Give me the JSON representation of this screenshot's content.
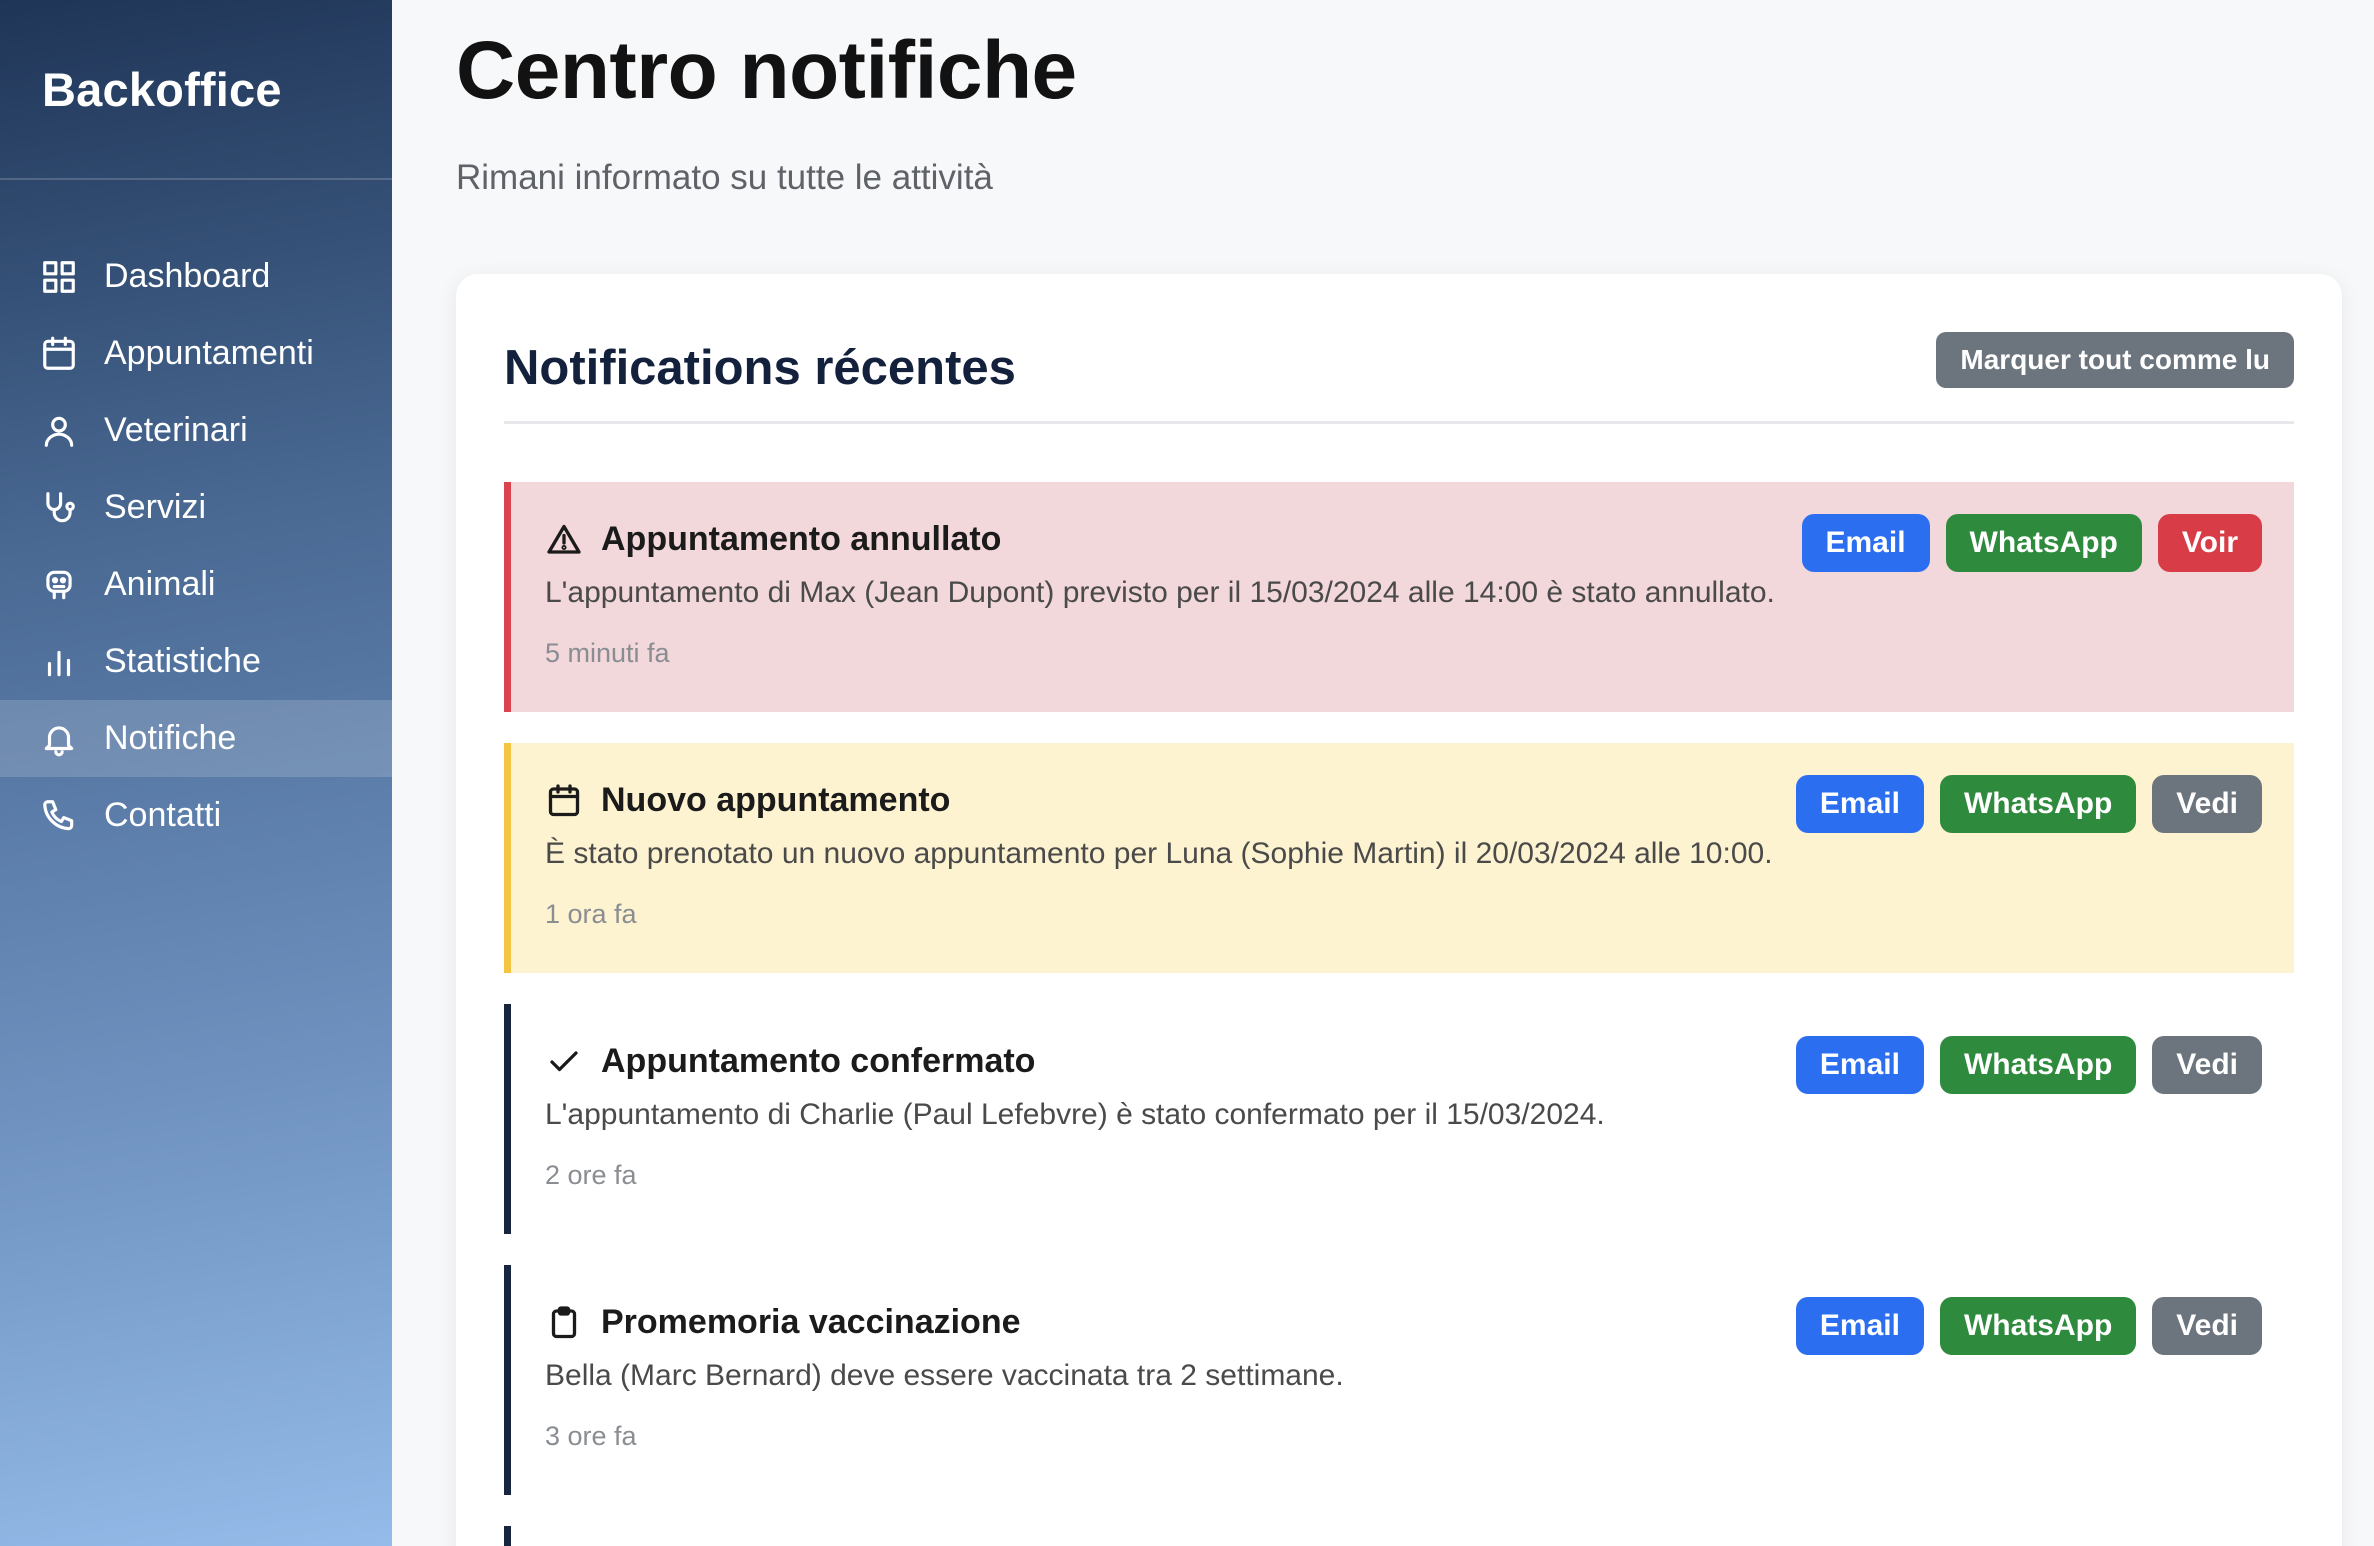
{
  "sidebar": {
    "brand": "Backoffice",
    "items": [
      {
        "label": "Dashboard",
        "icon": "grid-icon"
      },
      {
        "label": "Appuntamenti",
        "icon": "calendar-icon"
      },
      {
        "label": "Veterinari",
        "icon": "user-icon"
      },
      {
        "label": "Servizi",
        "icon": "stethoscope-icon"
      },
      {
        "label": "Animali",
        "icon": "pet-icon"
      },
      {
        "label": "Statistiche",
        "icon": "bar-chart-icon"
      },
      {
        "label": "Notifiche",
        "icon": "bell-icon",
        "active": true
      },
      {
        "label": "Contatti",
        "icon": "phone-icon"
      }
    ]
  },
  "header": {
    "title": "Centro notifiche",
    "subtitle": "Rimani informato su tutte le attività"
  },
  "card": {
    "title": "Notifications récentes",
    "mark_all_label": "Marquer tout comme lu"
  },
  "notifications": [
    {
      "type": "danger",
      "icon": "warning-triangle-icon",
      "title": "Appuntamento annullato",
      "text": "L'appuntamento di Max (Jean Dupont) previsto per il 15/03/2024 alle 14:00 è stato annullato.",
      "time": "5 minuti fa",
      "buttons": {
        "email": "Email",
        "whatsapp": "WhatsApp",
        "view": "Voir"
      }
    },
    {
      "type": "warning",
      "icon": "calendar-icon",
      "title": "Nuovo appuntamento",
      "text": "È stato prenotato un nuovo appuntamento per Luna (Sophie Martin) il 20/03/2024 alle 10:00.",
      "time": "1 ora fa",
      "buttons": {
        "email": "Email",
        "whatsapp": "WhatsApp",
        "view": "Vedi"
      }
    },
    {
      "type": "default",
      "icon": "check-icon",
      "title": "Appuntamento confermato",
      "text": "L'appuntamento di Charlie (Paul Lefebvre) è stato confermato per il 15/03/2024.",
      "time": "2 ore fa",
      "buttons": {
        "email": "Email",
        "whatsapp": "WhatsApp",
        "view": "Vedi"
      }
    },
    {
      "type": "default",
      "icon": "clipboard-icon",
      "title": "Promemoria vaccinazione",
      "text": "Bella (Marc Bernard) deve essere vaccinata tra 2 settimane.",
      "time": "3 ore fa",
      "buttons": {
        "email": "Email",
        "whatsapp": "WhatsApp",
        "view": "Vedi"
      }
    }
  ],
  "colors": {
    "danger": "#d9444e",
    "warning": "#f4c542",
    "email": "#2b6ff0",
    "whatsapp": "#2e8a3c",
    "neutral": "#6c757d",
    "dark_border": "#17253f"
  }
}
